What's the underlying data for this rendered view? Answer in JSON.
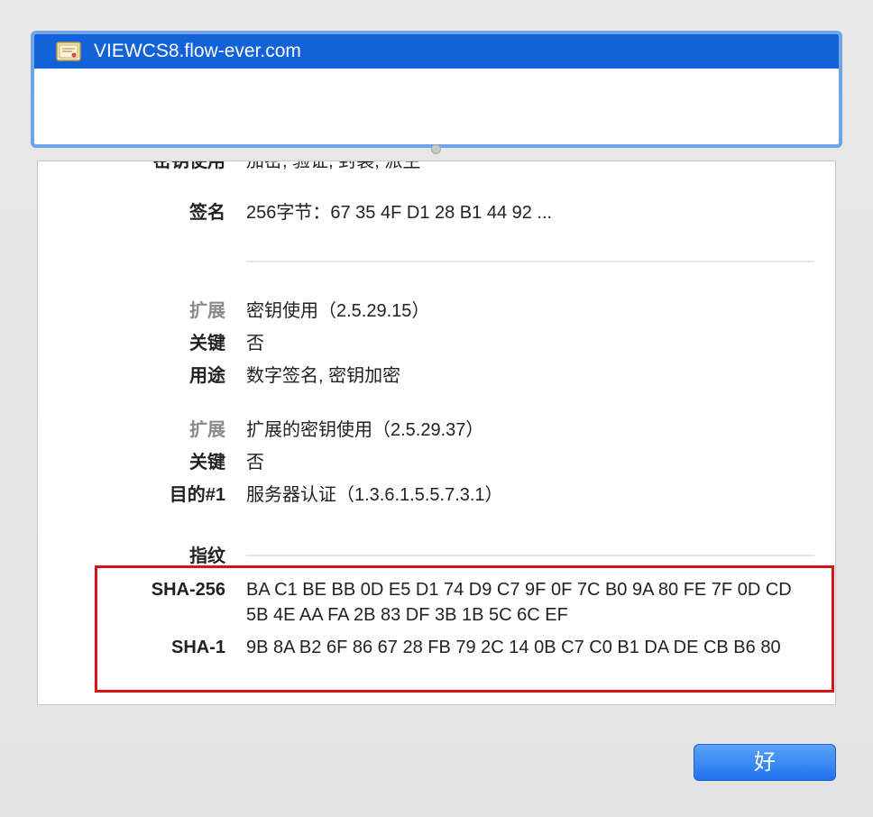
{
  "chain": {
    "selected_item": "VIEWCS8.flow-ever.com",
    "icon": "certificate-icon"
  },
  "details": {
    "cut_row": {
      "label": "密钥使用",
      "value": "加密, 验证, 封装, 派生"
    },
    "signature": {
      "label": "签名",
      "value": "256字节：67 35 4F D1 28 B1 44 92 ..."
    },
    "extension1": {
      "ext_label": "扩展",
      "ext_value": "密钥使用（2.5.29.15）",
      "critical_label": "关键",
      "critical_value": "否",
      "usage_label": "用途",
      "usage_value": "数字签名, 密钥加密"
    },
    "extension2": {
      "ext_label": "扩展",
      "ext_value": "扩展的密钥使用（2.5.29.37）",
      "critical_label": "关键",
      "critical_value": "否",
      "purpose_label": "目的#1",
      "purpose_value": "服务器认证（1.3.6.1.5.5.7.3.1）"
    },
    "fingerprints": {
      "label": "指纹",
      "sha256_label": "SHA-256",
      "sha256_value": "BA C1 BE BB 0D E5 D1 74 D9 C7 9F 0F 7C B0 9A 80 FE 7F 0D CD 5B 4E AA FA 2B 83 DF 3B 1B 5C 6C EF",
      "sha1_label": "SHA-1",
      "sha1_value": "9B 8A B2 6F 86 67 28 FB 79 2C 14 0B C7 C0 B1 DA DE CB B6 80"
    }
  },
  "buttons": {
    "ok_label": "好"
  },
  "colors": {
    "selection": "#1362d8",
    "highlight_border": "#d9121b",
    "button": "#1f73ef"
  }
}
